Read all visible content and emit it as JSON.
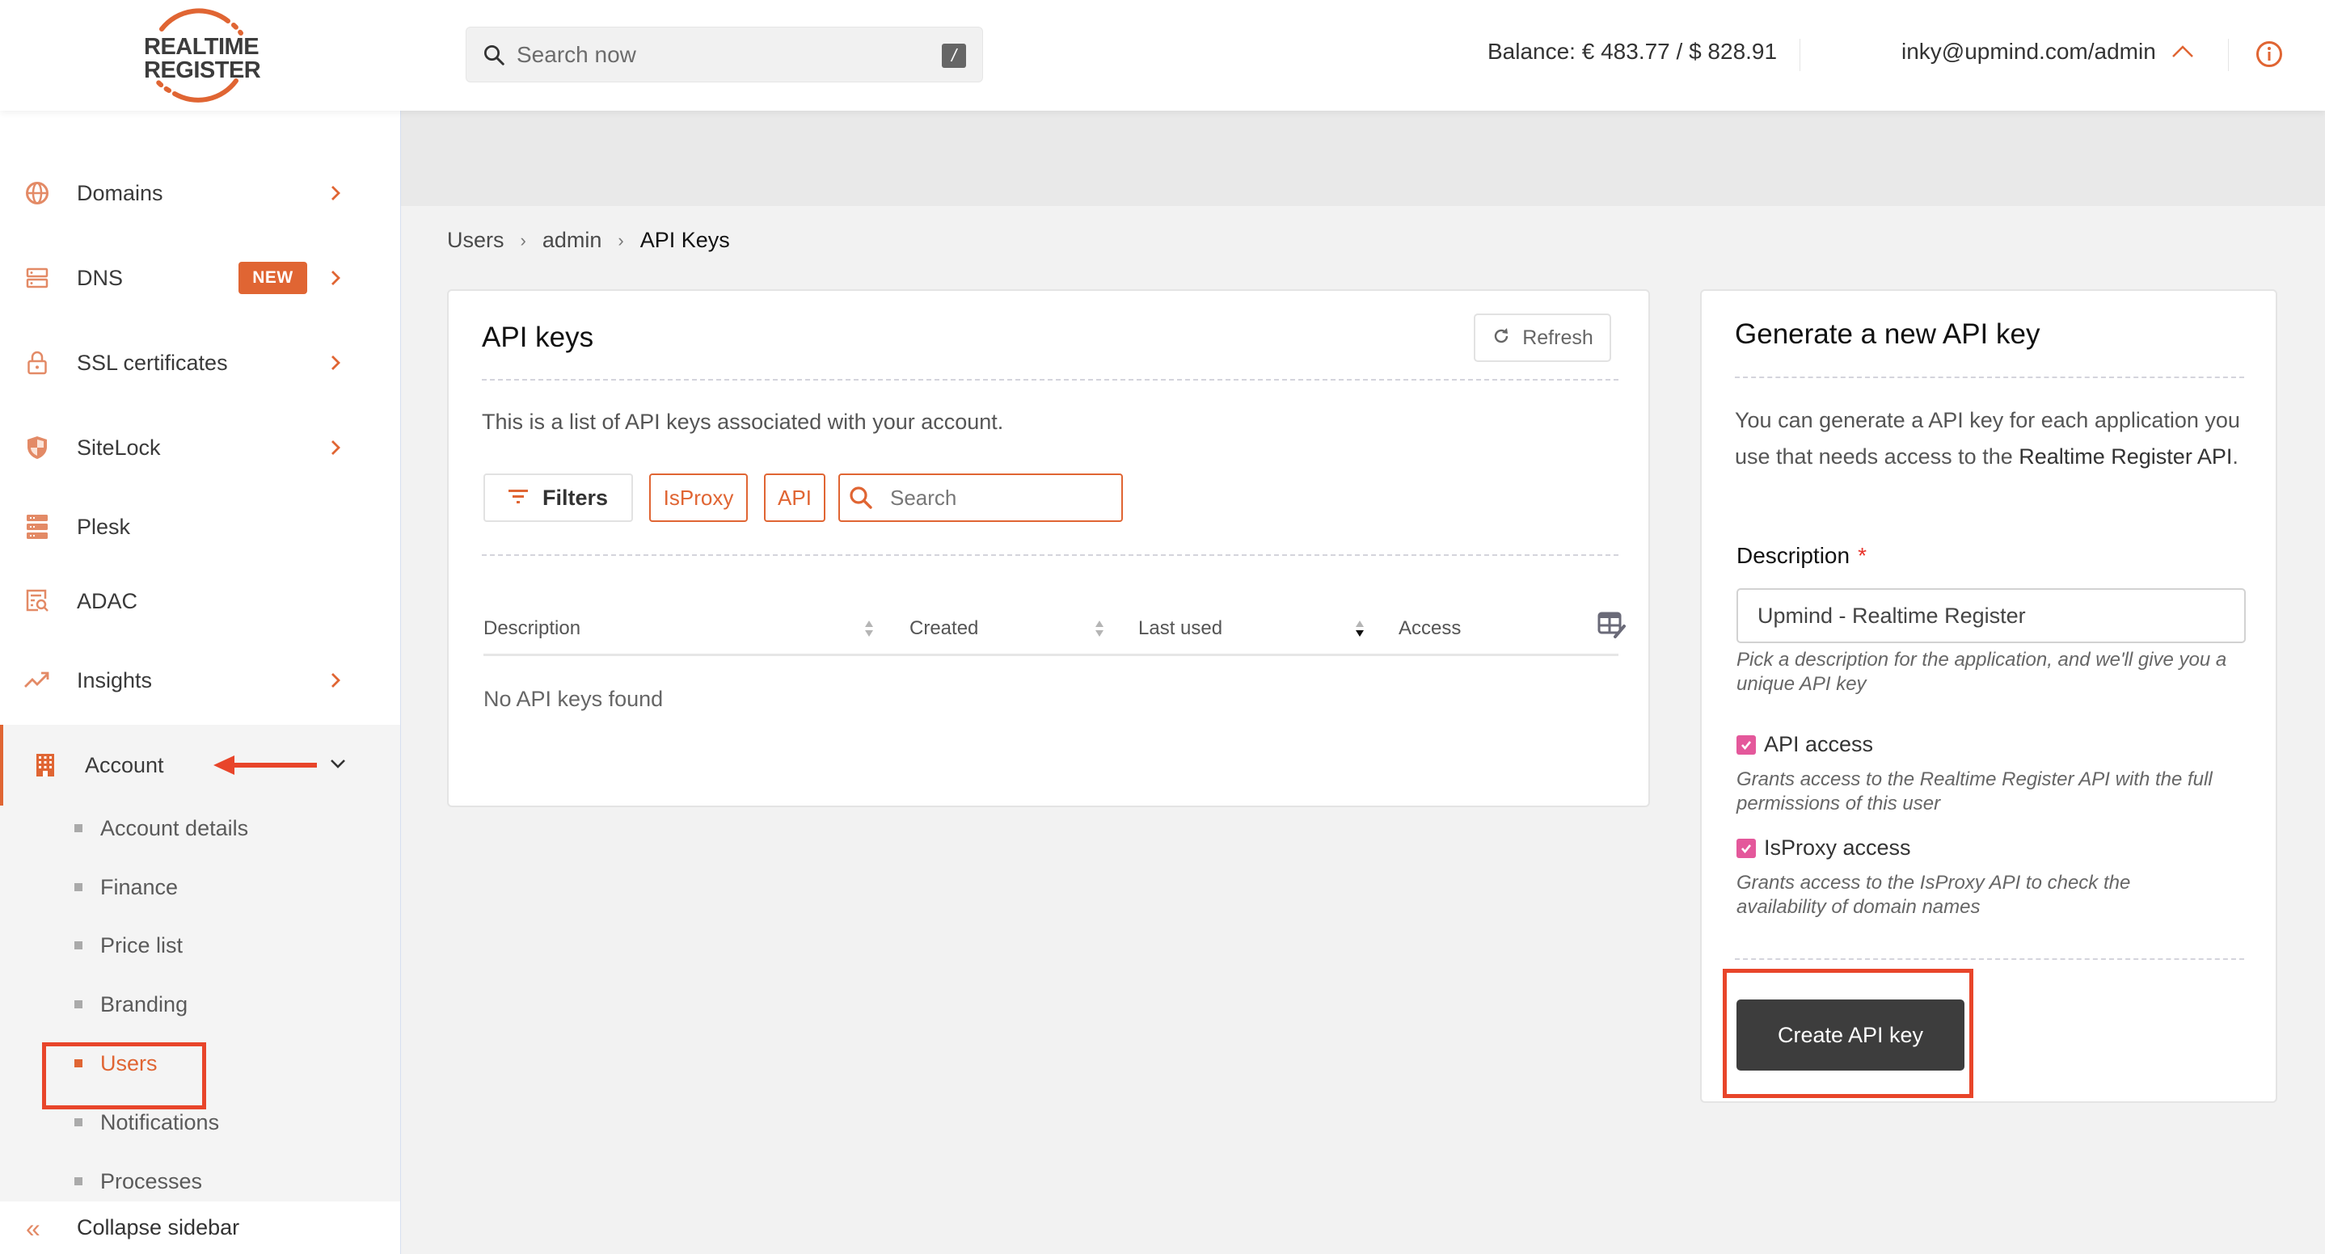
{
  "brand": {
    "logo_line1": "REALTIME",
    "logo_line2": "REGISTER",
    "accent_color": "#e06533"
  },
  "header": {
    "search_placeholder": "Search now",
    "search_shortcut": "/",
    "balance": "Balance: € 483.77 / $ 828.91",
    "user": "inky@upmind.com/admin"
  },
  "sidebar": {
    "items": [
      {
        "label": "Domains",
        "icon": "globe-icon",
        "has_submenu": true
      },
      {
        "label": "DNS",
        "icon": "server-icon",
        "badge": "NEW",
        "has_submenu": true
      },
      {
        "label": "SSL certificates",
        "icon": "lock-icon",
        "has_submenu": true
      },
      {
        "label": "SiteLock",
        "icon": "shield-icon",
        "has_submenu": true
      },
      {
        "label": "Plesk",
        "icon": "server-stack-icon",
        "has_submenu": false
      },
      {
        "label": "ADAC",
        "icon": "document-search-icon",
        "has_submenu": false
      },
      {
        "label": "Insights",
        "icon": "trending-up-icon",
        "has_submenu": true
      },
      {
        "label": "Account",
        "icon": "building-icon",
        "expanded": true
      }
    ],
    "account_submenu": [
      {
        "label": "Account details"
      },
      {
        "label": "Finance"
      },
      {
        "label": "Price list"
      },
      {
        "label": "Branding"
      },
      {
        "label": "Users",
        "active": true
      },
      {
        "label": "Notifications"
      },
      {
        "label": "Processes"
      }
    ],
    "collapse_label": "Collapse sidebar"
  },
  "breadcrumb": [
    "Users",
    "admin",
    "API Keys"
  ],
  "api_keys_card": {
    "title": "API keys",
    "refresh_label": "Refresh",
    "description": "This is a list of API keys associated with your account.",
    "filters_label": "Filters",
    "chips": [
      "IsProxy",
      "API"
    ],
    "search_placeholder": "Search",
    "columns": [
      "Description",
      "Created",
      "Last used",
      "Access"
    ],
    "sorted_column": "Last used",
    "sort_direction": "descending",
    "empty_message": "No API keys found",
    "rows": []
  },
  "generate_card": {
    "title": "Generate a new API key",
    "intro_part1": "You can generate a API key for each application you use that needs access to the ",
    "intro_part2": "Realtime Register API",
    "intro_part3": ".",
    "description_label": "Description",
    "required_mark": "*",
    "description_value": "Upmind - Realtime Register",
    "description_help": "Pick a description for the application, and we'll give you a unique API key",
    "api_access_label": "API access",
    "api_access_checked": true,
    "api_access_help": "Grants access to the Realtime Register API with the full permissions of this user",
    "isproxy_access_label": "IsProxy access",
    "isproxy_access_checked": true,
    "isproxy_access_help": "Grants access to the IsProxy API to check the availability of domain names",
    "create_label": "Create API key"
  }
}
